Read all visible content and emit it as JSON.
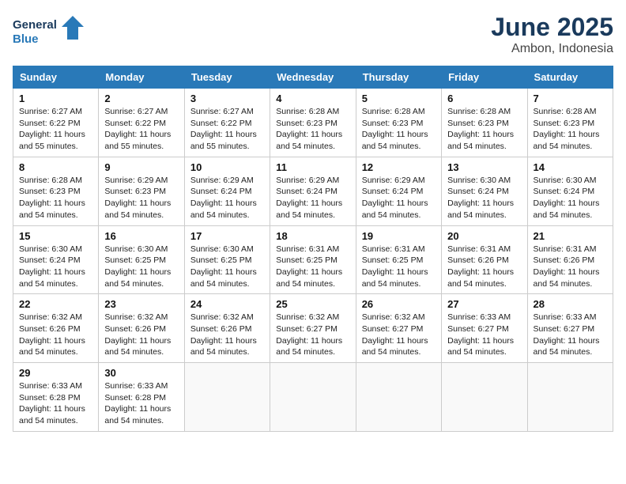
{
  "logo": {
    "line1": "General",
    "line2": "Blue"
  },
  "title": "June 2025",
  "location": "Ambon, Indonesia",
  "weekdays": [
    "Sunday",
    "Monday",
    "Tuesday",
    "Wednesday",
    "Thursday",
    "Friday",
    "Saturday"
  ],
  "weeks": [
    [
      {
        "day": "1",
        "sunrise": "6:27 AM",
        "sunset": "6:22 PM",
        "daylight": "11 hours and 55 minutes."
      },
      {
        "day": "2",
        "sunrise": "6:27 AM",
        "sunset": "6:22 PM",
        "daylight": "11 hours and 55 minutes."
      },
      {
        "day": "3",
        "sunrise": "6:27 AM",
        "sunset": "6:22 PM",
        "daylight": "11 hours and 55 minutes."
      },
      {
        "day": "4",
        "sunrise": "6:28 AM",
        "sunset": "6:23 PM",
        "daylight": "11 hours and 54 minutes."
      },
      {
        "day": "5",
        "sunrise": "6:28 AM",
        "sunset": "6:23 PM",
        "daylight": "11 hours and 54 minutes."
      },
      {
        "day": "6",
        "sunrise": "6:28 AM",
        "sunset": "6:23 PM",
        "daylight": "11 hours and 54 minutes."
      },
      {
        "day": "7",
        "sunrise": "6:28 AM",
        "sunset": "6:23 PM",
        "daylight": "11 hours and 54 minutes."
      }
    ],
    [
      {
        "day": "8",
        "sunrise": "6:28 AM",
        "sunset": "6:23 PM",
        "daylight": "11 hours and 54 minutes."
      },
      {
        "day": "9",
        "sunrise": "6:29 AM",
        "sunset": "6:23 PM",
        "daylight": "11 hours and 54 minutes."
      },
      {
        "day": "10",
        "sunrise": "6:29 AM",
        "sunset": "6:24 PM",
        "daylight": "11 hours and 54 minutes."
      },
      {
        "day": "11",
        "sunrise": "6:29 AM",
        "sunset": "6:24 PM",
        "daylight": "11 hours and 54 minutes."
      },
      {
        "day": "12",
        "sunrise": "6:29 AM",
        "sunset": "6:24 PM",
        "daylight": "11 hours and 54 minutes."
      },
      {
        "day": "13",
        "sunrise": "6:30 AM",
        "sunset": "6:24 PM",
        "daylight": "11 hours and 54 minutes."
      },
      {
        "day": "14",
        "sunrise": "6:30 AM",
        "sunset": "6:24 PM",
        "daylight": "11 hours and 54 minutes."
      }
    ],
    [
      {
        "day": "15",
        "sunrise": "6:30 AM",
        "sunset": "6:24 PM",
        "daylight": "11 hours and 54 minutes."
      },
      {
        "day": "16",
        "sunrise": "6:30 AM",
        "sunset": "6:25 PM",
        "daylight": "11 hours and 54 minutes."
      },
      {
        "day": "17",
        "sunrise": "6:30 AM",
        "sunset": "6:25 PM",
        "daylight": "11 hours and 54 minutes."
      },
      {
        "day": "18",
        "sunrise": "6:31 AM",
        "sunset": "6:25 PM",
        "daylight": "11 hours and 54 minutes."
      },
      {
        "day": "19",
        "sunrise": "6:31 AM",
        "sunset": "6:25 PM",
        "daylight": "11 hours and 54 minutes."
      },
      {
        "day": "20",
        "sunrise": "6:31 AM",
        "sunset": "6:26 PM",
        "daylight": "11 hours and 54 minutes."
      },
      {
        "day": "21",
        "sunrise": "6:31 AM",
        "sunset": "6:26 PM",
        "daylight": "11 hours and 54 minutes."
      }
    ],
    [
      {
        "day": "22",
        "sunrise": "6:32 AM",
        "sunset": "6:26 PM",
        "daylight": "11 hours and 54 minutes."
      },
      {
        "day": "23",
        "sunrise": "6:32 AM",
        "sunset": "6:26 PM",
        "daylight": "11 hours and 54 minutes."
      },
      {
        "day": "24",
        "sunrise": "6:32 AM",
        "sunset": "6:26 PM",
        "daylight": "11 hours and 54 minutes."
      },
      {
        "day": "25",
        "sunrise": "6:32 AM",
        "sunset": "6:27 PM",
        "daylight": "11 hours and 54 minutes."
      },
      {
        "day": "26",
        "sunrise": "6:32 AM",
        "sunset": "6:27 PM",
        "daylight": "11 hours and 54 minutes."
      },
      {
        "day": "27",
        "sunrise": "6:33 AM",
        "sunset": "6:27 PM",
        "daylight": "11 hours and 54 minutes."
      },
      {
        "day": "28",
        "sunrise": "6:33 AM",
        "sunset": "6:27 PM",
        "daylight": "11 hours and 54 minutes."
      }
    ],
    [
      {
        "day": "29",
        "sunrise": "6:33 AM",
        "sunset": "6:28 PM",
        "daylight": "11 hours and 54 minutes."
      },
      {
        "day": "30",
        "sunrise": "6:33 AM",
        "sunset": "6:28 PM",
        "daylight": "11 hours and 54 minutes."
      },
      null,
      null,
      null,
      null,
      null
    ]
  ]
}
